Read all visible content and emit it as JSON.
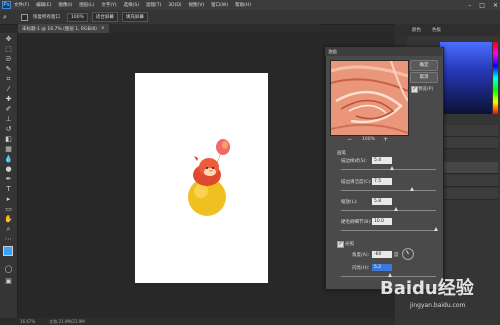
{
  "menubar": {
    "logo": "Ps",
    "items": [
      "文件(F)",
      "编辑(E)",
      "图像(I)",
      "图层(L)",
      "文字(Y)",
      "选择(S)",
      "滤镜(T)",
      "3D(D)",
      "视图(V)",
      "窗口(W)",
      "帮助(H)"
    ]
  },
  "window_controls": {
    "minimize": "–",
    "maximize": "□",
    "close": "✕"
  },
  "options": {
    "restore_label": "恢复所有窗口",
    "zoom_value": "100%",
    "fit_screen": "适合屏幕",
    "fill_screen": "填充屏幕"
  },
  "document": {
    "tab_title": "未标题-1 @ 16.7% (图层 1, RGB/8)",
    "tab_close": "×"
  },
  "status": {
    "zoom": "16.67%",
    "doc_info": "文档:21.9M/21.9M"
  },
  "right_panel": {
    "tab1": "颜色",
    "tab2": "色板"
  },
  "dialog": {
    "title": "油画",
    "ok": "确定",
    "cancel": "取消",
    "preview_label": "预览(P)",
    "preview_checked": true,
    "zoom_out": "−",
    "zoom_level": "100%",
    "zoom_in": "+",
    "brush_section": "画笔",
    "params": [
      {
        "label": "描边样式(S):",
        "value": "5.4",
        "level": 0.54
      },
      {
        "label": "描边清洁度(C):",
        "value": "7.5",
        "level": 0.75
      },
      {
        "label": "缩放(L):",
        "value": "5.8",
        "level": 0.58
      },
      {
        "label": "硬毛刷细节(B):",
        "value": "10.0",
        "level": 1.0
      }
    ],
    "lighting_section": "光照",
    "lighting_checked": true,
    "angle_label": "角度(A):",
    "angle_value": "-60",
    "angle_unit": "度",
    "shine_label": "闪亮(H):",
    "shine_value": "5.2",
    "shine_level": 0.52
  },
  "watermark": {
    "text": "Baidu经验",
    "sub": "jingyan.baidu.com"
  }
}
